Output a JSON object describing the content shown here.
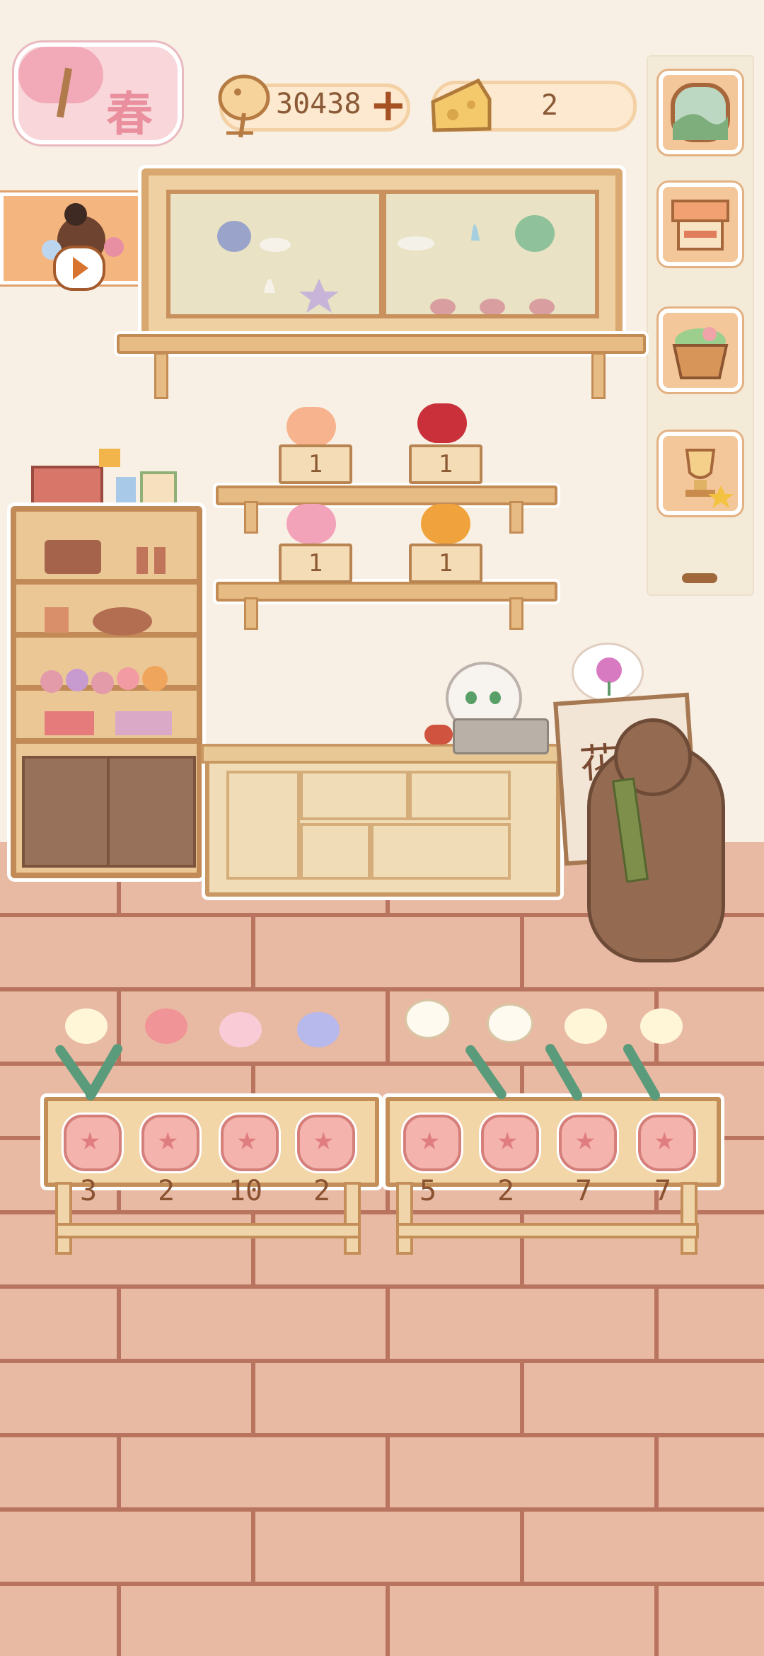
{
  "hud": {
    "season_label": "春",
    "fish_coins": "30438",
    "add_coins_label": "+",
    "cheese_count": "2"
  },
  "sidebar": {
    "buttons": [
      {
        "name": "window-scenery-icon"
      },
      {
        "name": "market-stall-icon"
      },
      {
        "name": "flower-basket-icon"
      },
      {
        "name": "trophy-icon"
      }
    ]
  },
  "shelves": {
    "bouquet_counts": [
      "1",
      "1",
      "1",
      "1"
    ]
  },
  "easel": {
    "sign_text": "花店"
  },
  "planters": {
    "left_counts": [
      "3",
      "2",
      "10",
      "2"
    ],
    "right_counts": [
      "5",
      "2",
      "7",
      "7"
    ]
  },
  "colors": {
    "wall": "#f8f0e4",
    "floor": "#e8b9a3",
    "wood": "#c18a56",
    "accent_pink": "#e98f9d"
  }
}
